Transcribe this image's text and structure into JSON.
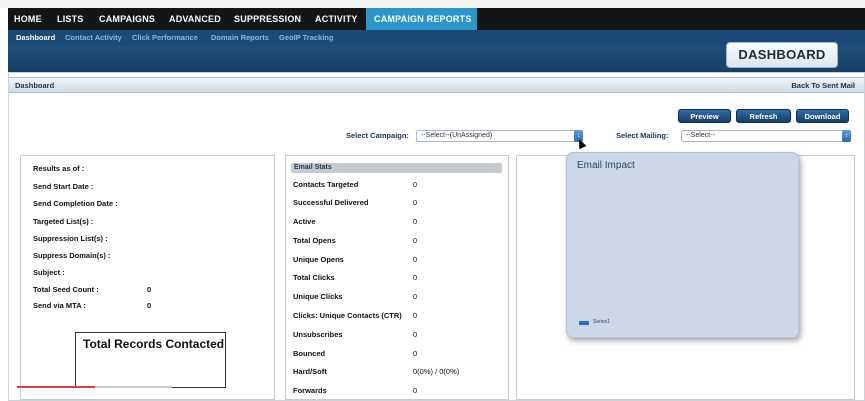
{
  "main_nav": {
    "items": [
      {
        "label": "HOME"
      },
      {
        "label": "LISTS"
      },
      {
        "label": "CAMPAIGNS"
      },
      {
        "label": "ADVANCED"
      },
      {
        "label": "SUPPRESSION"
      },
      {
        "label": "ACTIVITY"
      },
      {
        "label": "CAMPAIGN REPORTS",
        "active": true
      }
    ]
  },
  "sub_nav": {
    "items": [
      {
        "label": "Dashboard",
        "active": true
      },
      {
        "label": "Contact Activity"
      },
      {
        "label": "Click Performance"
      },
      {
        "label": "Domain Reports"
      },
      {
        "label": "GeoIP Tracking"
      }
    ]
  },
  "page_badge": "DASHBOARD",
  "content_header": {
    "title": "Dashboard",
    "back_link": "Back To Sent Mail"
  },
  "buttons": {
    "preview": "Preview",
    "refresh": "Refresh",
    "download": "Download"
  },
  "filters": {
    "campaign_label": "Select Campaign:",
    "campaign_value": "--Select--(UnAssigned)",
    "mailing_label": "Select Mailing:",
    "mailing_value": "--Select--"
  },
  "send_info": {
    "rows": [
      {
        "label": "Results as of :",
        "value": ""
      },
      {
        "label": "Send Start Date :",
        "value": ""
      },
      {
        "label": "Send Completion Date :",
        "value": ""
      },
      {
        "label": "Targeted List(s) :",
        "value": ""
      },
      {
        "label": "Suppression List(s) :",
        "value": ""
      },
      {
        "label": "Suppress Domain(s) :",
        "value": ""
      },
      {
        "label": "Subject :",
        "value": ""
      },
      {
        "label": "Total Seed Count :",
        "value": "0"
      },
      {
        "label": "Send via MTA :",
        "value": "0"
      }
    ],
    "records_title": "Total Records Contacted"
  },
  "email_stats": {
    "header": "Email Stats",
    "rows": [
      {
        "label": "Contacts Targeted",
        "value": "0"
      },
      {
        "label": "Successful Delivered",
        "value": "0"
      },
      {
        "label": "Active",
        "value": "0"
      },
      {
        "label": "Total Opens",
        "value": "0"
      },
      {
        "label": "Unique Opens",
        "value": "0"
      },
      {
        "label": "Total Clicks",
        "value": "0"
      },
      {
        "label": "Unique Clicks",
        "value": "0"
      },
      {
        "label": "Clicks: Unique Contacts (CTR)",
        "value": "0"
      },
      {
        "label": "Unsubscribes",
        "value": "0"
      },
      {
        "label": "Bounced",
        "value": "0"
      },
      {
        "label": "Hard/Soft",
        "value": "0(0%) / 0(0%)"
      },
      {
        "label": "Forwards",
        "value": "0"
      }
    ]
  },
  "email_impact": {
    "title": "Email Impact",
    "legend": "Series1",
    "legend_color": "#2f6bd8"
  },
  "video_progress": 0.5,
  "colors": {
    "nav_bg": "#151515",
    "nav_active": "#2b95cc",
    "subnav_bg": "#1b4a76",
    "button": "#1f5287",
    "progress": "#e53935"
  }
}
